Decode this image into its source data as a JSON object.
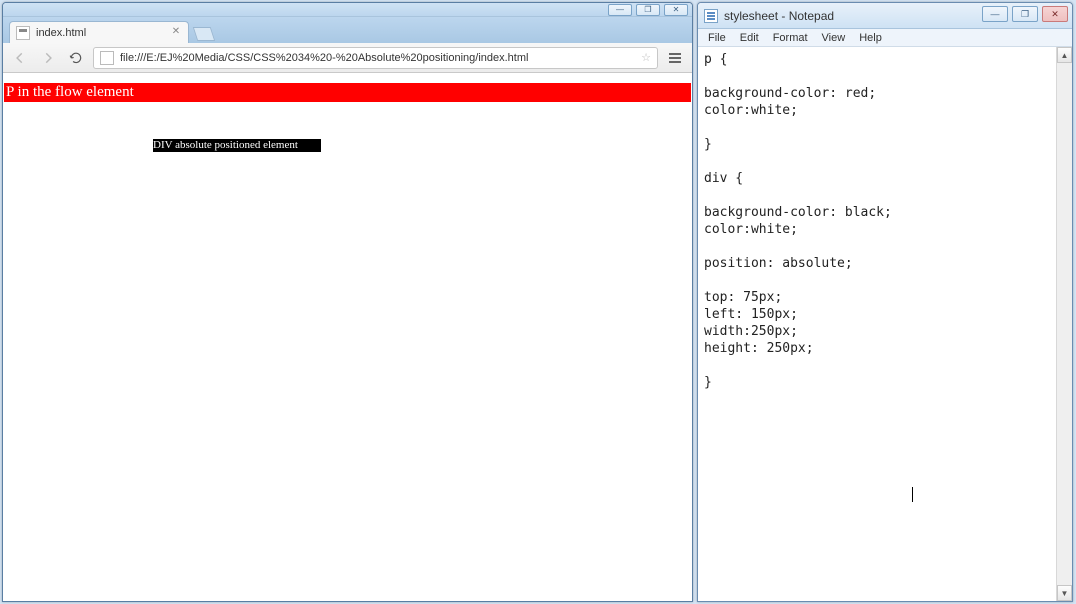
{
  "chrome": {
    "tab_title": "index.html",
    "url": "file:///E:/EJ%20Media/CSS/CSS%2034%20-%20Absolute%20positioning/index.html",
    "win_buttons": {
      "minimize": "—",
      "maximize": "❐",
      "close": "✕"
    },
    "page": {
      "p_text": "P in the flow element",
      "div_text": "DIV absolute positioned element"
    }
  },
  "notepad": {
    "title": "stylesheet - Notepad",
    "menus": {
      "file": "File",
      "edit": "Edit",
      "format": "Format",
      "view": "View",
      "help": "Help"
    },
    "win_buttons": {
      "minimize": "—",
      "maximize": "❐",
      "close": "✕"
    },
    "content": "p {\n\nbackground-color: red;\ncolor:white;\n\n}\n\ndiv {\n\nbackground-color: black;\ncolor:white;\n\nposition: absolute;\n\ntop: 75px;\nleft: 150px;\nwidth:250px;\nheight: 250px;\n\n}"
  }
}
